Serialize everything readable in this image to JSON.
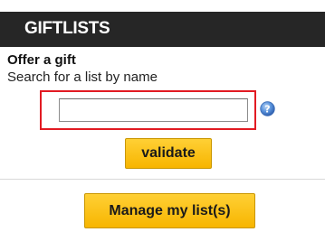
{
  "header": {
    "title": "GIFTLISTS"
  },
  "offer": {
    "label": "Offer a gift",
    "search_label": "Search for a list by name"
  },
  "search": {
    "value": "",
    "placeholder": "",
    "help_icon": "question-mark-icon"
  },
  "buttons": {
    "validate_label": "validate",
    "manage_label": "Manage my list(s)"
  },
  "colors": {
    "header_bg": "#262626",
    "header_text": "#ffffff",
    "button_bg": "#f9bd16",
    "highlight_border": "#e21b23",
    "help_icon": "#3f7fd6"
  }
}
